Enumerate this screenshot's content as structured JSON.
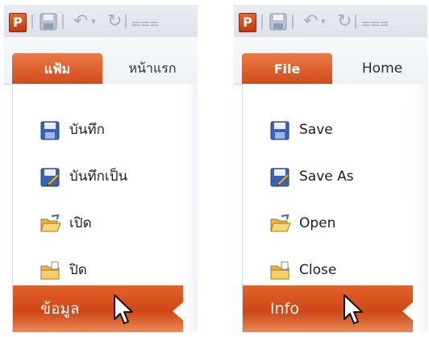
{
  "panels": [
    {
      "file_tab": "แฟ้ม",
      "home_tab": "หน้าแรก",
      "menu": {
        "save": "บันทึก",
        "save_as": "บันทึกเป็น",
        "open": "เปิด",
        "close": "ปิด",
        "info": "ข้อมูล"
      },
      "logo_letter": "P"
    },
    {
      "file_tab": "File",
      "home_tab": "Home",
      "menu": {
        "save": "Save",
        "save_as": "Save As",
        "open": "Open",
        "close": "Close",
        "info": "Info"
      },
      "logo_letter": "P"
    }
  ],
  "icons": [
    "powerpoint-logo-icon",
    "save-icon",
    "undo-icon",
    "redo-icon",
    "customize-qat-icon",
    "save-as-icon",
    "open-folder-icon",
    "close-folder-icon",
    "mouse-cursor-icon"
  ],
  "colors": {
    "accent": "#d24b1b",
    "file_tab": "#e06a34",
    "qat_bg": "#e3e8ee",
    "text": "#1f1f1f"
  }
}
